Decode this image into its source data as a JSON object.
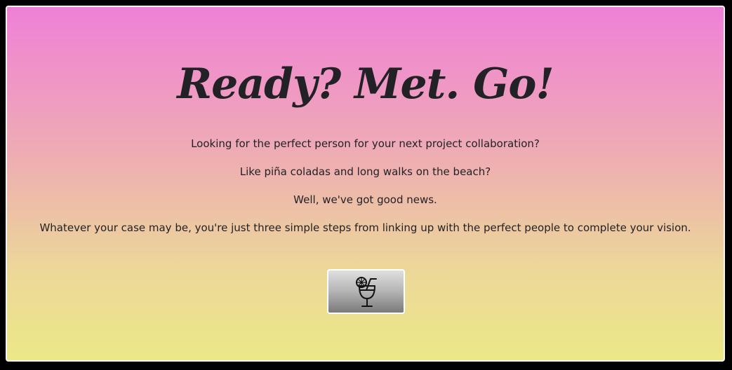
{
  "hero": {
    "title": "Ready? Met. Go!",
    "paragraphs": [
      "Looking for the perfect person for your next project collaboration?",
      "Like piña coladas and long walks on the beach?",
      "Well, we've got good news.",
      "Whatever your case may be, you're just three simple steps from linking up with the perfect people to complete your vision."
    ]
  },
  "cta": {
    "icon": "cocktail-icon"
  },
  "colors": {
    "gradient_top": "#f080d8",
    "gradient_bottom": "#ece888",
    "text": "#222226"
  }
}
